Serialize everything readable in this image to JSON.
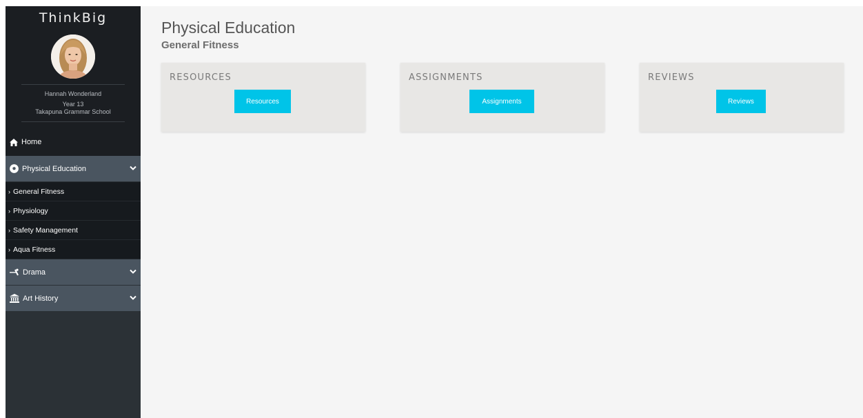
{
  "sidebar": {
    "brand": "ThinkBig",
    "profile": {
      "name": "Hannah Wonderland",
      "year": "Year 13",
      "school": "Takapuna Grammar School"
    },
    "home_label": "Home",
    "groups": [
      {
        "label": "Physical Education",
        "icon": "soccer-ball-icon",
        "items": [
          "General Fitness",
          "Physiology",
          "Safety Management",
          "Aqua Fitness"
        ]
      },
      {
        "label": "Drama",
        "icon": "fencing-icon",
        "items": []
      },
      {
        "label": "Art History",
        "icon": "museum-icon",
        "items": []
      }
    ]
  },
  "main": {
    "title": "Physical Education",
    "subtitle": "General Fitness",
    "cards": [
      {
        "title": "RESOURCES",
        "button": "Resources"
      },
      {
        "title": "ASSIGNMENTS",
        "button": "Assignments"
      },
      {
        "title": "REVIEWS",
        "button": "Reviews"
      }
    ]
  },
  "colors": {
    "sidebar_bg": "#2b3136",
    "sidebar_dark": "#1b1e22",
    "group_bg": "#4a5560",
    "accent": "#00c4e8",
    "card_bg": "#e8e7e5",
    "main_bg": "#f5f5f5"
  }
}
